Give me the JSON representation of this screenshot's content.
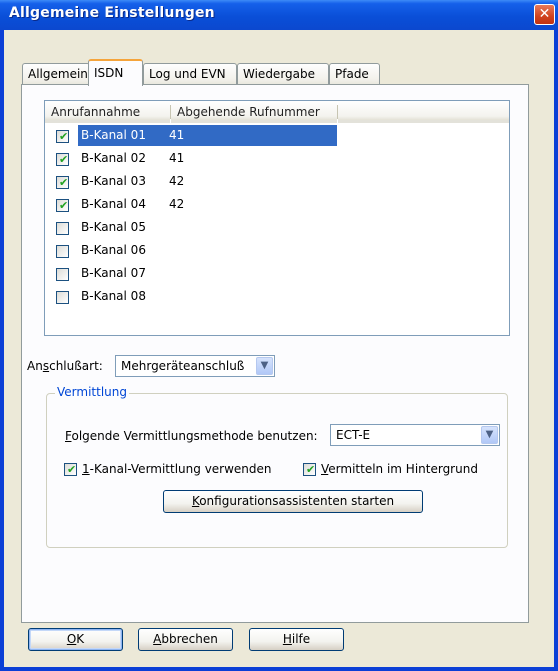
{
  "window": {
    "title": "Allgemeine Einstellungen",
    "close_symbol": "✕"
  },
  "tabs": [
    {
      "label": "Allgemein"
    },
    {
      "label": "ISDN"
    },
    {
      "label": "Log und EVN"
    },
    {
      "label": "Wiedergabe"
    },
    {
      "label": "Pfade"
    }
  ],
  "listview": {
    "columns": [
      "Anrufannahme",
      "Abgehende Rufnummer"
    ],
    "rows": [
      {
        "name": "B-Kanal 01",
        "number": "41",
        "checked": true,
        "selected": true
      },
      {
        "name": "B-Kanal 02",
        "number": "41",
        "checked": true,
        "selected": false
      },
      {
        "name": "B-Kanal 03",
        "number": "42",
        "checked": true,
        "selected": false
      },
      {
        "name": "B-Kanal 04",
        "number": "42",
        "checked": true,
        "selected": false
      },
      {
        "name": "B-Kanal 05",
        "number": "",
        "checked": false,
        "selected": false
      },
      {
        "name": "B-Kanal 06",
        "number": "",
        "checked": false,
        "selected": false
      },
      {
        "name": "B-Kanal 07",
        "number": "",
        "checked": false,
        "selected": false
      },
      {
        "name": "B-Kanal 08",
        "number": "",
        "checked": false,
        "selected": false
      }
    ]
  },
  "anschluss": {
    "label_pre": "An",
    "label_key": "s",
    "label_post": "chlußart:",
    "value": "Mehrgeräteanschluß"
  },
  "vermittlung": {
    "group_title": "Vermittlung",
    "method_label_key": "F",
    "method_label_post": "olgende Vermittlungsmethode benutzen:",
    "method_value": "ECT-E",
    "opt1_key": "1",
    "opt1_post": "-Kanal-Vermittlung verwenden",
    "opt1_checked": true,
    "opt2_key": "V",
    "opt2_post": "ermitteln im Hintergrund",
    "opt2_checked": true,
    "wizard_key": "K",
    "wizard_post": "onfigurationsassistenten starten"
  },
  "buttons": {
    "ok_key": "O",
    "ok_post": "K",
    "cancel_key": "A",
    "cancel_post": "bbrechen",
    "help_key": "H",
    "help_post": "ilfe"
  },
  "icons": {
    "checkmark": "✔",
    "dropdown": "▼"
  },
  "colors": {
    "titlebar": "#0a4fd8",
    "selection": "#316ac5",
    "tab_highlight": "#f5a43b",
    "group_title": "#0046d5"
  }
}
